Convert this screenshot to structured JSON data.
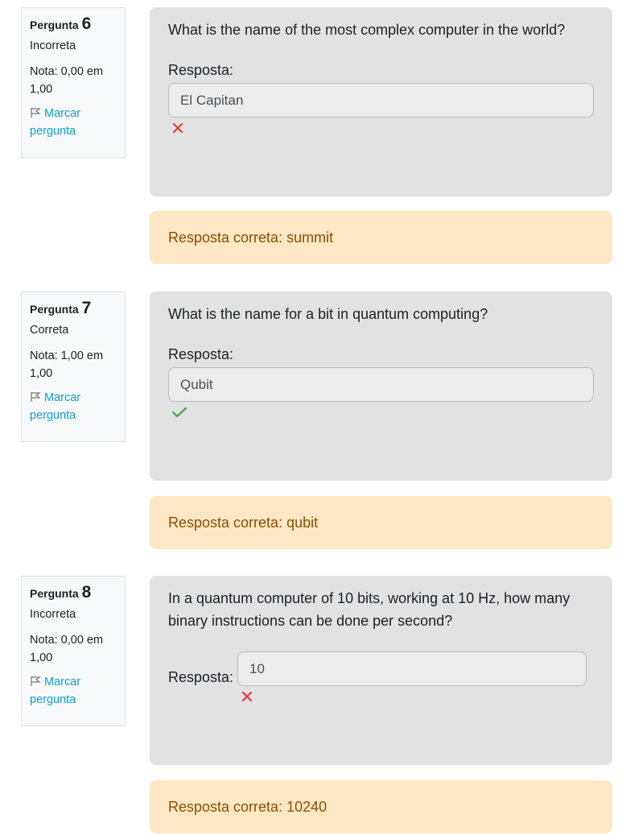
{
  "questions": [
    {
      "label": "Pergunta",
      "number": "6",
      "state": "Incorreta",
      "grade": "Nota: 0,00 em 1,00",
      "flag": "Marcar pergunta",
      "text": "What is the name of the most complex computer in the world?",
      "answer_label": "Resposta:",
      "answer": "El Capitan",
      "result": "incorrect",
      "correct_answer": "Resposta correta: summit"
    },
    {
      "label": "Pergunta",
      "number": "7",
      "state": "Correta",
      "grade": "Nota: 1,00 em 1,00",
      "flag": "Marcar pergunta",
      "text": "What is the name for a bit in quantum computing?",
      "answer_label": "Resposta:",
      "answer": "Qubit",
      "result": "correct",
      "correct_answer": "Resposta correta: qubit"
    },
    {
      "label": "Pergunta",
      "number": "8",
      "state": "Incorreta",
      "grade": "Nota: 0,00 em 1,00",
      "flag": "Marcar pergunta",
      "text": "In a quantum computer of 10 bits, working at 10 Hz, how many binary instructions can be done per second?",
      "answer_label": "Resposta:",
      "answer": "10",
      "result": "incorrect",
      "correct_answer": "Resposta correta: 10240"
    }
  ],
  "colors": {
    "incorrect": "#e53935",
    "correct": "#43a047",
    "flag_link": "#0f9ed8",
    "feedback_bg": "#fde7c4",
    "feedback_text": "#8b4f00",
    "content_bg": "#e2e2e2"
  },
  "icons": {
    "flag": "flag-icon",
    "incorrect": "cross-icon",
    "correct": "check-icon"
  }
}
